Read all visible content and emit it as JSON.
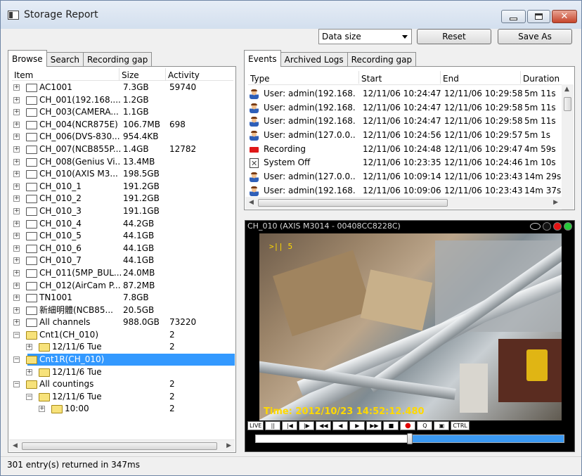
{
  "window": {
    "title": "Storage Report"
  },
  "toolbar": {
    "select_value": "Data size",
    "reset_label": "Reset",
    "saveas_label": "Save As"
  },
  "left_tabs": [
    "Browse",
    "Search",
    "Recording gap"
  ],
  "tree": {
    "headers": [
      "Item",
      "Size",
      "Activity"
    ],
    "rows": [
      {
        "label": "AC1001",
        "size": "7.3GB",
        "activity": "59740",
        "level": 0
      },
      {
        "label": "CH_001(192.168....",
        "size": "1.2GB",
        "activity": "",
        "level": 0
      },
      {
        "label": "CH_003(CAMERA...",
        "size": "1.1GB",
        "activity": "",
        "level": 0
      },
      {
        "label": "CH_004(NCR875E)",
        "size": "106.7MB",
        "activity": "698",
        "level": 0
      },
      {
        "label": "CH_006(DVS-830...",
        "size": "954.4KB",
        "activity": "",
        "level": 0
      },
      {
        "label": "CH_007(NCB855P...",
        "size": "1.4GB",
        "activity": "12782",
        "level": 0
      },
      {
        "label": "CH_008(Genius Vi...",
        "size": "13.4MB",
        "activity": "",
        "level": 0
      },
      {
        "label": "CH_010(AXIS M3...",
        "size": "198.5GB",
        "activity": "",
        "level": 0
      },
      {
        "label": "CH_010_1",
        "size": "191.2GB",
        "activity": "",
        "level": 0
      },
      {
        "label": "CH_010_2",
        "size": "191.2GB",
        "activity": "",
        "level": 0
      },
      {
        "label": "CH_010_3",
        "size": "191.1GB",
        "activity": "",
        "level": 0
      },
      {
        "label": "CH_010_4",
        "size": "44.2GB",
        "activity": "",
        "level": 0
      },
      {
        "label": "CH_010_5",
        "size": "44.1GB",
        "activity": "",
        "level": 0
      },
      {
        "label": "CH_010_6",
        "size": "44.1GB",
        "activity": "",
        "level": 0
      },
      {
        "label": "CH_010_7",
        "size": "44.1GB",
        "activity": "",
        "level": 0
      },
      {
        "label": "CH_011(5MP_BUL...",
        "size": "24.0MB",
        "activity": "",
        "level": 0
      },
      {
        "label": "CH_012(AirCam P...",
        "size": "87.2MB",
        "activity": "",
        "level": 0
      },
      {
        "label": "TN1001",
        "size": "7.8GB",
        "activity": "",
        "level": 0
      },
      {
        "label": "新細明體(NCB85...",
        "size": "20.5GB",
        "activity": "",
        "level": 0
      },
      {
        "label": "All channels",
        "size": "988.0GB",
        "activity": "73220",
        "level": 0
      },
      {
        "label": "Cnt1(CH_010)",
        "size": "",
        "activity": "2",
        "level": 0,
        "open": true
      },
      {
        "label": "12/11/6 Tue",
        "size": "",
        "activity": "2",
        "level": 1
      },
      {
        "label": "Cnt1R(CH_010)",
        "size": "",
        "activity": "",
        "level": 0,
        "open": true,
        "selected": true
      },
      {
        "label": "12/11/6 Tue",
        "size": "",
        "activity": "",
        "level": 1
      },
      {
        "label": "All countings",
        "size": "",
        "activity": "2",
        "level": 0,
        "open": true
      },
      {
        "label": "12/11/6 Tue",
        "size": "",
        "activity": "2",
        "level": 1,
        "open": true
      },
      {
        "label": "10:00",
        "size": "",
        "activity": "2",
        "level": 2
      }
    ]
  },
  "right_tabs": [
    "Events",
    "Archived Logs",
    "Recording gap"
  ],
  "events": {
    "headers": [
      "Type",
      "Start",
      "End",
      "Duration"
    ],
    "rows": [
      {
        "icon": "user-icon",
        "type": "User: admin(192.168....",
        "start": "12/11/06 10:24:47",
        "end": "12/11/06 10:29:58",
        "duration": "5m 11s"
      },
      {
        "icon": "user-icon",
        "type": "User: admin(192.168....",
        "start": "12/11/06 10:24:47",
        "end": "12/11/06 10:29:58",
        "duration": "5m 11s"
      },
      {
        "icon": "user-icon",
        "type": "User: admin(192.168....",
        "start": "12/11/06 10:24:47",
        "end": "12/11/06 10:29:58",
        "duration": "5m 11s"
      },
      {
        "icon": "user-icon",
        "type": "User: admin(127.0.0....",
        "start": "12/11/06 10:24:56",
        "end": "12/11/06 10:29:57",
        "duration": "5m 1s"
      },
      {
        "icon": "recording-icon",
        "type": "Recording",
        "start": "12/11/06 10:24:48",
        "end": "12/11/06 10:29:47",
        "duration": "4m 59s"
      },
      {
        "icon": "system-off-icon",
        "type": "System Off",
        "start": "12/11/06 10:23:35",
        "end": "12/11/06 10:24:46",
        "duration": "1m 10s"
      },
      {
        "icon": "user-icon",
        "type": "User: admin(127.0.0....",
        "start": "12/11/06 10:09:14",
        "end": "12/11/06 10:23:43",
        "duration": "14m 29s"
      },
      {
        "icon": "user-icon",
        "type": "User: admin(192.168....",
        "start": "12/11/06 10:09:06",
        "end": "12/11/06 10:23:43",
        "duration": "14m 37s"
      }
    ]
  },
  "camera": {
    "title": "CH_010 (AXIS M3014 - 00408CC8228C)",
    "osd": ">|| 5",
    "timestamp": "Time: 2012/10/23 14:52:12.480",
    "controls": [
      "LIVE",
      "||",
      "|◀",
      "|▶",
      "◀◀",
      "◀",
      "▶",
      "▶▶",
      "■",
      "●",
      "Q",
      "▣",
      "CTRL"
    ],
    "progress": 0.5
  },
  "status": {
    "text": "301 entry(s) returned in 347ms"
  },
  "colors": {
    "selection": "#3399ff",
    "timeline": "#3b99f2",
    "osd": "#ffd900"
  }
}
